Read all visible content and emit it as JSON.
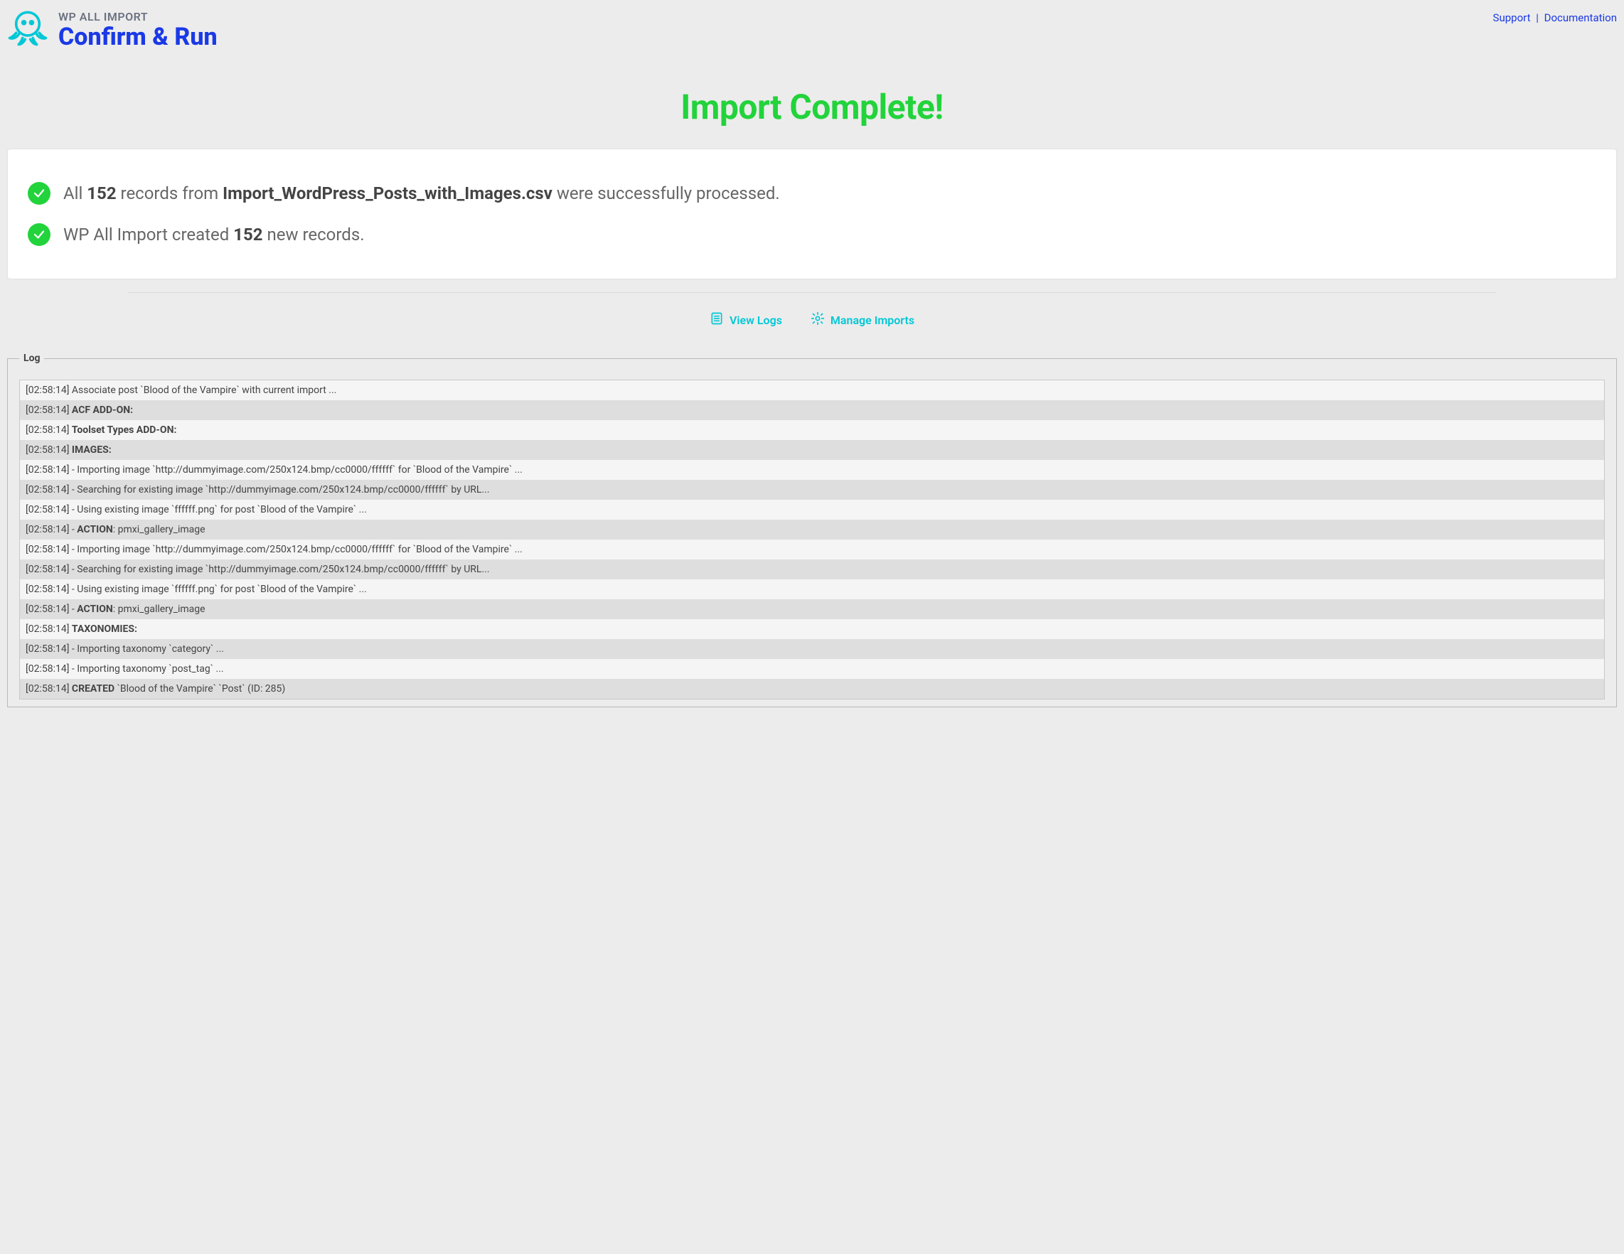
{
  "header": {
    "eyebrow": "WP ALL IMPORT",
    "title": "Confirm & Run",
    "links": {
      "support": "Support",
      "docs": "Documentation"
    }
  },
  "hero": {
    "heading": "Import Complete!"
  },
  "summary": {
    "line1": {
      "pre": "All ",
      "count": "152",
      "mid": " records from ",
      "file": "Import_WordPress_Posts_with_Images.csv",
      "post": " were successfully processed."
    },
    "line2": {
      "pre": "WP All Import created ",
      "count": "152",
      "post": " new records."
    }
  },
  "actions": {
    "view_logs": "View Logs",
    "manage_imports": "Manage Imports"
  },
  "log": {
    "legend": "Log",
    "rows": [
      {
        "ts": "[02:58:14]",
        "html": "Associate post `Blood of the Vampire` with current import ..."
      },
      {
        "ts": "[02:58:14]",
        "html": "<b>ACF ADD-ON:</b>"
      },
      {
        "ts": "[02:58:14]",
        "html": "<b>Toolset Types ADD-ON:</b>"
      },
      {
        "ts": "[02:58:14]",
        "html": "<b>IMAGES:</b>"
      },
      {
        "ts": "[02:58:14]",
        "html": "- Importing image `http://dummyimage.com/250x124.bmp/cc0000/ffffff` for `Blood of the Vampire` ..."
      },
      {
        "ts": "[02:58:14]",
        "html": "- Searching for existing image `http://dummyimage.com/250x124.bmp/cc0000/ffffff` by URL..."
      },
      {
        "ts": "[02:58:14]",
        "html": "- Using existing image `ffffff.png` for post `Blood of the Vampire` ..."
      },
      {
        "ts": "[02:58:14]",
        "html": "- <b>ACTION</b>: pmxi_gallery_image"
      },
      {
        "ts": "[02:58:14]",
        "html": "- Importing image `http://dummyimage.com/250x124.bmp/cc0000/ffffff` for `Blood of the Vampire` ..."
      },
      {
        "ts": "[02:58:14]",
        "html": "- Searching for existing image `http://dummyimage.com/250x124.bmp/cc0000/ffffff` by URL..."
      },
      {
        "ts": "[02:58:14]",
        "html": "- Using existing image `ffffff.png` for post `Blood of the Vampire` ..."
      },
      {
        "ts": "[02:58:14]",
        "html": "- <b>ACTION</b>: pmxi_gallery_image"
      },
      {
        "ts": "[02:58:14]",
        "html": "<b>TAXONOMIES:</b>"
      },
      {
        "ts": "[02:58:14]",
        "html": "- Importing taxonomy `category` ..."
      },
      {
        "ts": "[02:58:14]",
        "html": "- Importing taxonomy `post_tag` ..."
      },
      {
        "ts": "[02:58:14]",
        "html": "<b>CREATED</b> `Blood of the Vampire` `Post` (ID: 285)"
      }
    ]
  }
}
